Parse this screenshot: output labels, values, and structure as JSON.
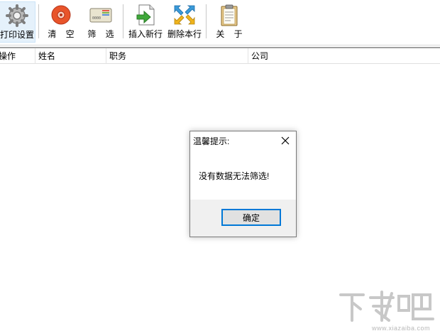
{
  "toolbar": {
    "print_settings": "打印设置",
    "clear": "清    空",
    "filter": "筛    选",
    "insert_row": "插入新行",
    "delete_row": "删除本行",
    "about": "关    于"
  },
  "grid": {
    "columns": [
      "操作",
      "姓名",
      "职务",
      "公司"
    ]
  },
  "dialog": {
    "title": "温馨提示:",
    "message": "没有数据无法筛选!",
    "ok_label": "确定"
  },
  "watermark": {
    "logo_text": "下载吧",
    "url": "www.xiazaiba.com"
  },
  "colors": {
    "accent": "#0078d7",
    "active_button_bg": "#e5f1fb",
    "dialog_footer_bg": "#f0f0f0"
  }
}
